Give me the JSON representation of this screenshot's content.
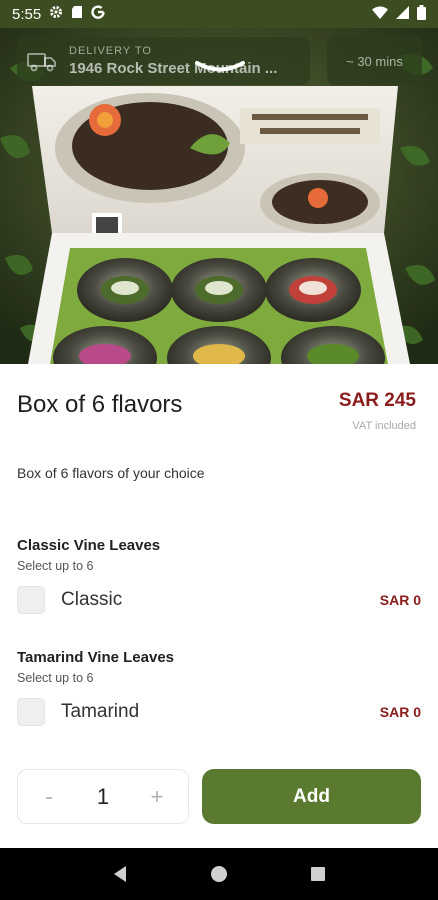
{
  "status_bar": {
    "time": "5:55",
    "icons": [
      "gear-icon",
      "sd-card-icon",
      "google-icon",
      "wifi-icon",
      "signal-icon",
      "battery-icon"
    ]
  },
  "delivery": {
    "label": "DELIVERY TO",
    "address": "1946 Rock Street Mountain ...",
    "eta": "~ 30 mins"
  },
  "product": {
    "title": "Box of 6 flavors",
    "price": "SAR 245",
    "vat_note": "VAT included",
    "description": "Box of 6 flavors of your choice"
  },
  "option_groups": [
    {
      "title": "Classic Vine Leaves",
      "subtitle": "Select up to 6",
      "options": [
        {
          "label": "Classic",
          "price": "SAR 0",
          "checked": false
        }
      ]
    },
    {
      "title": "Tamarind Vine Leaves",
      "subtitle": "Select up to 6",
      "options": [
        {
          "label": "Tamarind",
          "price": "SAR 0",
          "checked": false
        }
      ]
    }
  ],
  "quantity": {
    "minus": "-",
    "value": "1",
    "plus": "+"
  },
  "add_button": {
    "label": "Add"
  },
  "colors": {
    "accent_green": "#5a7a2f",
    "price_red": "#8a1c1c",
    "status_bar": "#3d4d22"
  }
}
